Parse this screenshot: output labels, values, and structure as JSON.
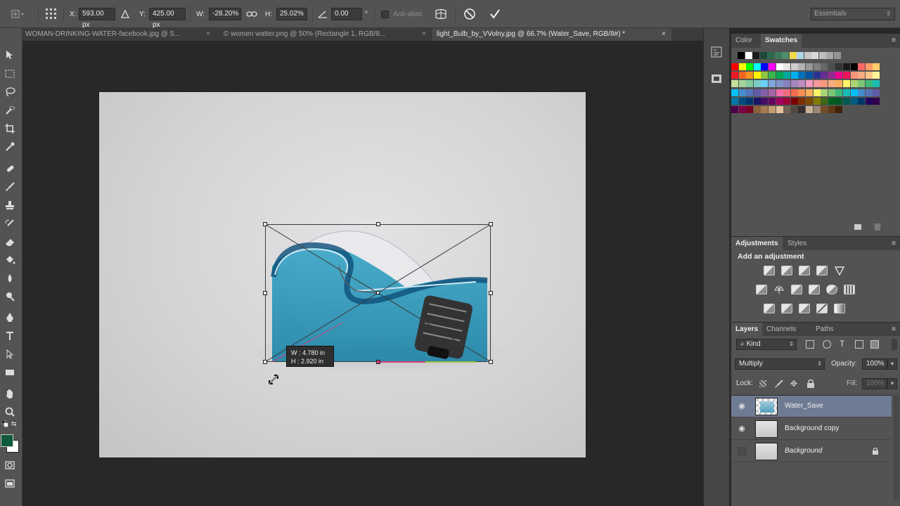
{
  "options": {
    "x_label": "X:",
    "x_value": "593.00 px",
    "y_label": "Y:",
    "y_value": "425.00 px",
    "w_label": "W:",
    "w_value": "-28.20%",
    "h_label": "H:",
    "h_value": "25.02%",
    "angle_value": "0.00",
    "degree": "°",
    "antialias_label": "Anti-alias",
    "workspace": "Essentials"
  },
  "tabs": [
    {
      "label": "WOMAN-DRINKING-WATER-facebook.jpg @ 5...",
      "active": false
    },
    {
      "label": "© women watter.png @ 50% (Rectangle 1, RGB/8...",
      "active": false
    },
    {
      "label": "light_Bulb_by_VVolny.jpg @ 66.7% (Water_Save, RGB/8#) *",
      "active": true
    }
  ],
  "tab_close": "×",
  "tooltip": {
    "w": "W :   4.780 in",
    "h": "H :   2.920 in"
  },
  "swatches_panel": {
    "tab_color": "Color",
    "tab_swatches": "Swatches"
  },
  "adjustments_panel": {
    "tab_adjustments": "Adjustments",
    "tab_styles": "Styles",
    "heading": "Add an adjustment"
  },
  "layers_panel": {
    "tab_layers": "Layers",
    "tab_channels": "Channels",
    "tab_paths": "Paths",
    "kind": "Kind",
    "blend_mode": "Multiply",
    "opacity_label": "Opacity:",
    "opacity_value": "100%",
    "lock_label": "Lock:",
    "fill_label": "Fill:",
    "fill_value": "100%",
    "layers": [
      {
        "name": "Water_Save",
        "visible": true,
        "selected": true
      },
      {
        "name": "Background copy",
        "visible": true,
        "selected": false
      },
      {
        "name": "Background",
        "visible": false,
        "selected": false,
        "locked": true
      }
    ]
  },
  "colors": {
    "foreground": "#0f5a3b",
    "background": "#ffffff",
    "swatch_row0": [
      "#000000",
      "#ffffff",
      "#1a1a1a",
      "#1c4a37",
      "#2d6a4f",
      "#3d7a5d",
      "#4f8c68",
      "#f2d94e",
      "#aed6e8",
      "#c7c7c7",
      "#d9d9d9",
      "#bdbdbd",
      "#a8a8a8",
      "#949494"
    ],
    "swatch_grid": [
      [
        "#ff0000",
        "#ffff00",
        "#00ff00",
        "#00ffff",
        "#0000ff",
        "#ff00ff",
        "#ffffff",
        "#e6e6e6",
        "#cccccc",
        "#b3b3b3",
        "#999999",
        "#808080",
        "#666666",
        "#4d4d4d",
        "#333333",
        "#1a1a1a",
        "#000000",
        "#ff6666",
        "#ff9966",
        "#ffcc66"
      ],
      [
        "#ed1c24",
        "#f26522",
        "#f7941d",
        "#fff200",
        "#8dc63f",
        "#39b54a",
        "#00a651",
        "#00a99d",
        "#00aeef",
        "#0072bc",
        "#0054a6",
        "#2e3192",
        "#662d91",
        "#92278f",
        "#ec008c",
        "#ed145b",
        "#f69679",
        "#f9ad81",
        "#fdc689",
        "#fff799"
      ],
      [
        "#c4df9b",
        "#a3d39c",
        "#82ca9c",
        "#7accc8",
        "#6dcff6",
        "#7da7d9",
        "#8393ca",
        "#8781bd",
        "#a186be",
        "#bd8cbf",
        "#f49ac1",
        "#f5989d",
        "#f7977a",
        "#f9ad81",
        "#fbaf5d",
        "#fff568",
        "#acd372",
        "#7cc576",
        "#3cb878",
        "#1cbbb4"
      ],
      [
        "#00bff3",
        "#448ccb",
        "#5574b9",
        "#605ca8",
        "#8560a8",
        "#a864a8",
        "#f06eaa",
        "#f26d7d",
        "#f26c4f",
        "#f68e56",
        "#fbaf5d",
        "#fff467",
        "#acd373",
        "#7cc576",
        "#3bb878",
        "#1abbb4",
        "#00bff3",
        "#438ccb",
        "#5573b7",
        "#5e5ca7"
      ],
      [
        "#0076a3",
        "#004a80",
        "#003471",
        "#1b1464",
        "#440e62",
        "#630460",
        "#9e005d",
        "#9e0039",
        "#790000",
        "#7b2e00",
        "#7d4900",
        "#827b00",
        "#406618",
        "#005e20",
        "#005826",
        "#005952",
        "#005b7f",
        "#003663",
        "#21005d",
        "#32004b"
      ],
      [
        "#4b0049",
        "#7b0046",
        "#7a0026",
        "#8c6239",
        "#a67c52",
        "#c69c6d",
        "#e5c29f",
        "#736357",
        "#534741",
        "#362f2d",
        "#c7b299",
        "#998675",
        "#754c24",
        "#603913",
        "#42210b"
      ]
    ]
  }
}
